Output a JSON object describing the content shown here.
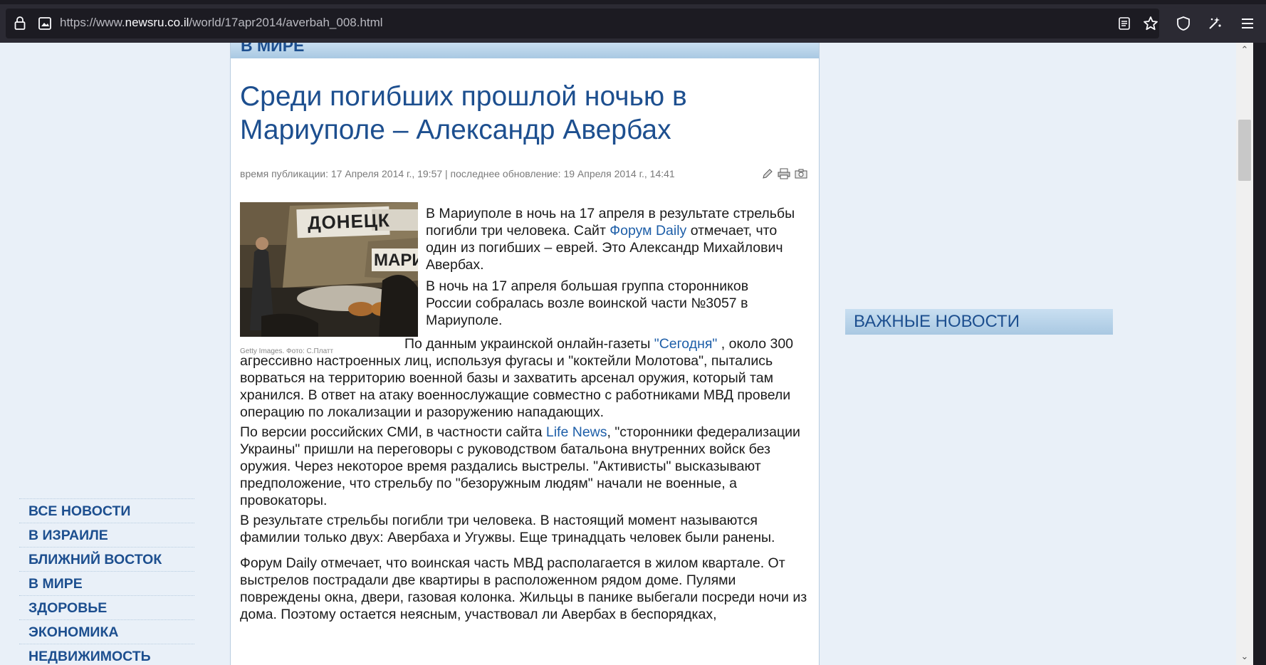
{
  "browser": {
    "url_prefix": "https://www.",
    "url_domain": "newsru.co.il",
    "url_path": "/world/17apr2014/averbah_008.html",
    "icons": [
      "lock-icon",
      "page-info-icon",
      "reader-view-icon",
      "bookmark-star-icon",
      "shield-icon",
      "extensions-icon",
      "menu-icon"
    ]
  },
  "rubric": "В МИРЕ",
  "article": {
    "title": "Среди погибших прошлой ночью в Мариуполе – Александр Авербах",
    "meta": "время публикации: 17 Апреля 2014 г., 19:57 | последнее обновление: 19 Апреля 2014 г., 14:41",
    "photo_banner_text": "ДОНЕЦК",
    "photo_sign_text": "МАРИ",
    "photo_caption": "Getty Images. Фото: С.Платт",
    "p1_a": "В Мариуполе в ночь на 17 апреля в результате стрельбы погибли три человека. Сайт ",
    "p1_link": "Форум Daily",
    "p1_b": " отмечает, что один из погибших – еврей. Это Александр Михайлович Авербах.",
    "p2": "В ночь на 17 апреля большая группа сторонников России собралась возле воинской части №3057 в Мариуполе.",
    "p3_a": "По данным украинской онлайн-газеты ",
    "p3_link": "\"Сегодня\"",
    "p3_b": " , около 300 агрессивно настроенных лиц, используя фугасы и \"коктейли Молотова\", пытались ворваться на территорию военной базы и захватить арсенал оружия, который там хранился. В ответ на атаку военнослужащие совместно с работниками МВД провели операцию по локализации и разоружению нападающих.",
    "p4_a": "По версии российских СМИ, в частности сайта ",
    "p4_link": "Life News",
    "p4_b": ", \"сторонники федерализации Украины\" пришли на переговоры с руководством батальона внутренних войск без оружия. Через некоторое время раздались выстрелы. \"Активисты\" высказывают предположение, что стрельбу по \"безоружным людям\" начали не военные, а провокаторы.",
    "p5": "В результате стрельбы погибли три человека. В настоящий момент называются фамилии только двух: Авербаха и Угужвы. Еще тринадцать человек были ранены.",
    "p6": "Форум Daily отмечает, что воинская часть МВД располагается в жилом квартале. От выстрелов пострадали две квартиры в расположенном рядом доме. Пулями повреждены окна, двери, газовая колонка. Жильцы в панике выбегали посреди ночи из дома. Поэтому остается неясным, участвовал ли Авербах в беспорядках,"
  },
  "nav": {
    "items": [
      "ВСЕ НОВОСТИ",
      "В ИЗРАИЛЕ",
      "БЛИЖНИЙ ВОСТОК",
      "В МИРЕ",
      "ЗДОРОВЬЕ",
      "ЭКОНОМИКА",
      "НЕДВИЖИМОСТЬ"
    ]
  },
  "sidebar_right": {
    "important_title": "ВАЖНЫЕ НОВОСТИ"
  }
}
